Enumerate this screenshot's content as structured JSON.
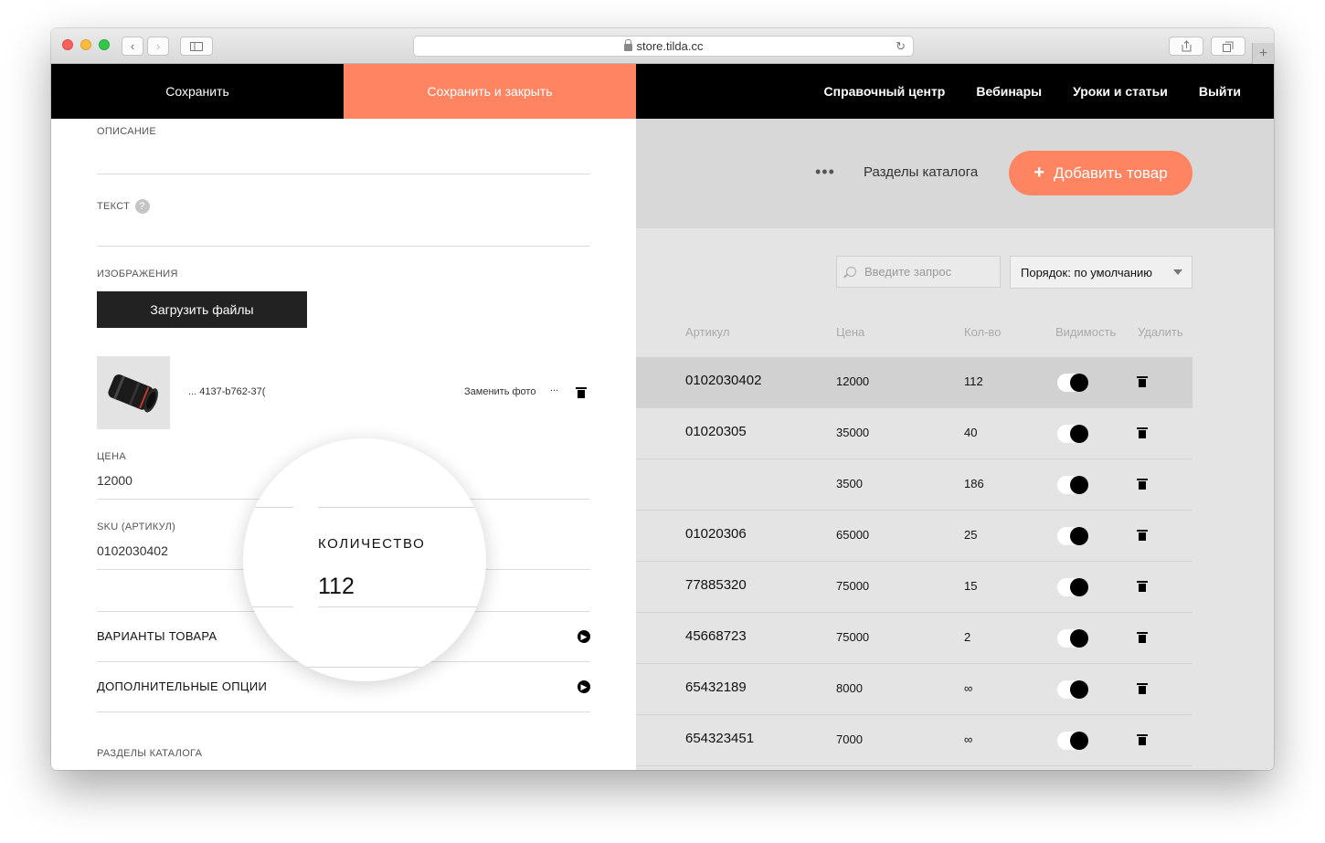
{
  "browser": {
    "url": "store.tilda.cc"
  },
  "topbar": {
    "save_label": "Сохранить",
    "save_close_label": "Сохранить и закрыть",
    "nav": [
      "Справочный центр",
      "Вебинары",
      "Уроки и статьи",
      "Выйти"
    ]
  },
  "catalog": {
    "sections_link": "Разделы каталога",
    "add_button": "Добавить товар",
    "search_placeholder": "Введите запрос",
    "sort_label": "Порядок: по умолчанию",
    "columns": [
      "Артикул",
      "Цена",
      "Кол-во",
      "Видимость",
      "Удалить"
    ],
    "rows": [
      {
        "sku": "0102030402",
        "price": "12000",
        "qty": "112",
        "visible": true
      },
      {
        "sku": "01020305",
        "price": "35000",
        "qty": "40",
        "visible": true
      },
      {
        "sku": "",
        "price": "3500",
        "qty": "186",
        "visible": true
      },
      {
        "sku": "01020306",
        "price": "65000",
        "qty": "25",
        "visible": true
      },
      {
        "sku": "77885320",
        "price": "75000",
        "qty": "15",
        "visible": true
      },
      {
        "sku": "45668723",
        "price": "75000",
        "qty": "2",
        "visible": true
      },
      {
        "sku": "65432189",
        "price": "8000",
        "qty": "∞",
        "visible": true
      },
      {
        "sku": "654323451",
        "price": "7000",
        "qty": "∞",
        "visible": true
      }
    ]
  },
  "form": {
    "description_label": "ОПИСАНИЕ",
    "text_label": "ТЕКСТ",
    "text_help": "?",
    "images_label": "ИЗОБРАЖЕНИЯ",
    "upload_button": "Загрузить файлы",
    "image_filename": "... 4137-b762-37(",
    "replace_photo": "Заменить фото",
    "image_more": "...",
    "price_label": "ЦЕНА",
    "price_value": "12000",
    "sku_label": "SKU (АРТИКУЛ)",
    "sku_value": "0102030402",
    "variants_label": "ВАРИАНТЫ ТОВАРА",
    "extra_options_label": "ДОПОЛНИТЕЛЬНЫЕ ОПЦИИ",
    "catalog_sections_label": "РАЗДЕЛЫ КАТАЛОГА"
  },
  "magnifier": {
    "label": "КОЛИЧЕСТВО",
    "value": "112"
  },
  "colors": {
    "accent": "#ff8562",
    "topbar": "#000000",
    "catalog_bg": "#e4e4e4"
  }
}
